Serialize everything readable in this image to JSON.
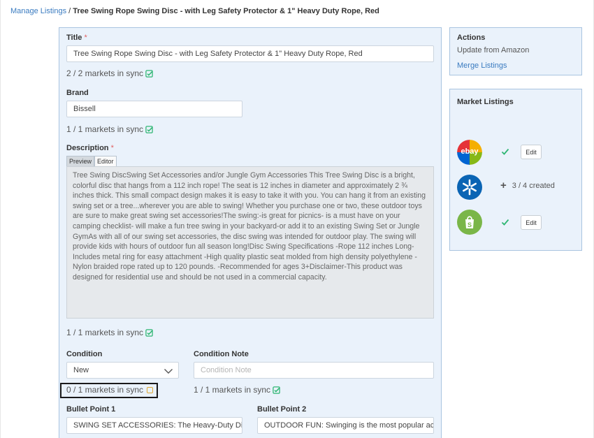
{
  "breadcrumb": {
    "link": "Manage Listings",
    "separator": " / ",
    "current": "Tree Swing Rope Swing Disc - with Leg Safety Protector & 1\" Heavy Duty Rope, Red"
  },
  "form": {
    "title_label": "Title",
    "required_mark": "*",
    "title_value": "Tree Swing Rope Swing Disc - with Leg Safety Protector & 1\" Heavy Duty Rope, Red",
    "title_sync": "2 / 2 markets in sync",
    "brand_label": "Brand",
    "brand_value": "Bissell",
    "brand_sync": "1 / 1 markets in sync",
    "description_label": "Description",
    "preview_tab": "Preview",
    "editor_tab": "Editor",
    "description_text": "Tree Swing DiscSwing Set Accessories and/or Jungle Gym Accessories This Tree Swing Disc is a bright, colorful disc that hangs from a 112 inch rope! The seat is 12 inches in diameter and approximately 2 ¾ inches thick. This small compact design makes it is easy to take it with you. You can hang it from an existing swing set or a tree...wherever you are able to swing! Whether you purchase one or two, these outdoor toys are sure to make great swing set accessories!The swing:-is great for picnics- is a must have on your camping checklist- will make a fun tree swing in your backyard-or add it to an existing Swing Set or Jungle GymAs with all of our swing set accessories, the disc swing was intended for outdoor play. The swing will provide kids with hours of outdoor fun all season long!Disc Swing Specifications -Rope 112 inches Long-Includes metal ring for easy attachment -High quality plastic seat molded from high density polyethylene -Nylon braided rope rated up to 120 pounds. -Recommended for ages 3+Disclaimer-This product was designed for residential use and should be not used in a commercial capacity.",
    "description_sync": "1 / 1 markets in sync",
    "condition_label": "Condition",
    "condition_value": "New",
    "condition_sync": "0 / 1 markets in sync",
    "condition_note_label": "Condition Note",
    "condition_note_placeholder": "Condition Note",
    "condition_note_sync": "1 / 1 markets in sync",
    "bullet1_label": "Bullet Point 1",
    "bullet1_value": "SWING SET ACCESSORIES: The Heavy-Duty Disc Sv",
    "bullet2_label": "Bullet Point 2",
    "bullet2_value": "OUTDOOR FUN: Swinging is the most popular acti"
  },
  "actions": {
    "title": "Actions",
    "update_text": "Update from Amazon",
    "merge_link": "Merge Listings"
  },
  "market_listings": {
    "title": "Market Listings",
    "ebay_logo_text": "ebay",
    "edit_label": "Edit",
    "walmart_created": "3 / 4 created"
  },
  "colors": {
    "accent": "#3a7bc0",
    "sync_ok": "#2fb673",
    "sync_pending": "#e0a832",
    "panel_bg": "#eaf2fb",
    "panel_border": "#a9c4e0",
    "ebay_bg": "#1a7bc8",
    "walmart_bg": "#0a64b4",
    "shopify_bg": "#7ab648"
  }
}
